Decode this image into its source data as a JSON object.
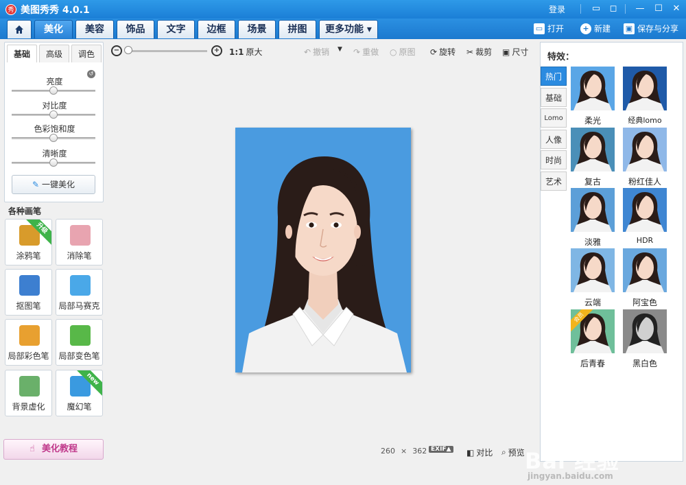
{
  "app": {
    "title": "美图秀秀 4.0.1",
    "logo_text": "秀",
    "login": "登录"
  },
  "menu": {
    "tabs": [
      "美化",
      "美容",
      "饰品",
      "文字",
      "边框",
      "场景",
      "拼图",
      "更多功能 ▾"
    ],
    "open": "打开",
    "new": "新建",
    "save_share": "保存与分享"
  },
  "adjust": {
    "tabs": [
      "基础",
      "高级",
      "调色"
    ],
    "sliders": [
      {
        "label": "亮度",
        "value": 0.5
      },
      {
        "label": "对比度",
        "value": 0.5
      },
      {
        "label": "色彩饱和度",
        "value": 0.5
      },
      {
        "label": "清晰度",
        "value": 0.5
      }
    ],
    "one_click": "一键美化"
  },
  "brushes": {
    "heading": "各种画笔",
    "items": [
      {
        "label": "涂鸦笔",
        "badge": "升级",
        "color": "#d89b2b"
      },
      {
        "label": "消除笔",
        "badge": "",
        "color": "#e8a4b0"
      },
      {
        "label": "抠图笔",
        "badge": "",
        "color": "#3d7fd0"
      },
      {
        "label": "局部马赛克",
        "badge": "",
        "color": "#4aa8e8"
      },
      {
        "label": "局部彩色笔",
        "badge": "",
        "color": "#e8a030"
      },
      {
        "label": "局部变色笔",
        "badge": "",
        "color": "#58b848"
      },
      {
        "label": "背景虚化",
        "badge": "",
        "color": "#6ab06a"
      },
      {
        "label": "魔幻笔",
        "badge": "new",
        "color": "#3a9ae0"
      }
    ]
  },
  "tutorial": "美化教程",
  "canvas_toolbar": {
    "zoom_level": 0.0,
    "actual_size": "1:1",
    "actual_size_label": "原大",
    "undo": "撤销",
    "redo": "重做",
    "original": "原图",
    "rotate": "旋转",
    "crop": "裁剪",
    "resize": "尺寸"
  },
  "status": {
    "width": "260",
    "times": "×",
    "height": "362",
    "exif": "EXIF▲",
    "compare": "对比",
    "preview": "预览"
  },
  "effects": {
    "heading": "特效：",
    "categories": [
      "热门",
      "基础",
      "Lomo",
      "人像",
      "时尚",
      "艺术"
    ],
    "items": [
      {
        "label": "柔光",
        "tint": "#5aa6e6",
        "vip": ""
      },
      {
        "label": "经典lomo",
        "tint": "#1f5aa8",
        "vip": ""
      },
      {
        "label": "复古",
        "tint": "#4a8fb8",
        "vip": ""
      },
      {
        "label": "粉红佳人",
        "tint": "#8fb8e8",
        "vip": ""
      },
      {
        "label": "淡雅",
        "tint": "#5c9fd8",
        "vip": ""
      },
      {
        "label": "HDR",
        "tint": "#3f86d2",
        "vip": ""
      },
      {
        "label": "云端",
        "tint": "#7fb6e4",
        "vip": ""
      },
      {
        "label": "阿宝色",
        "tint": "#6aa8de",
        "vip": ""
      },
      {
        "label": "后青春",
        "tint": "#6fbf9a",
        "vip": "会员"
      },
      {
        "label": "黑白色",
        "tint": "#8a8a8a",
        "vip": ""
      }
    ]
  },
  "watermark": {
    "brand": "Bai 经验",
    "url": "jingyan.baidu.com"
  }
}
